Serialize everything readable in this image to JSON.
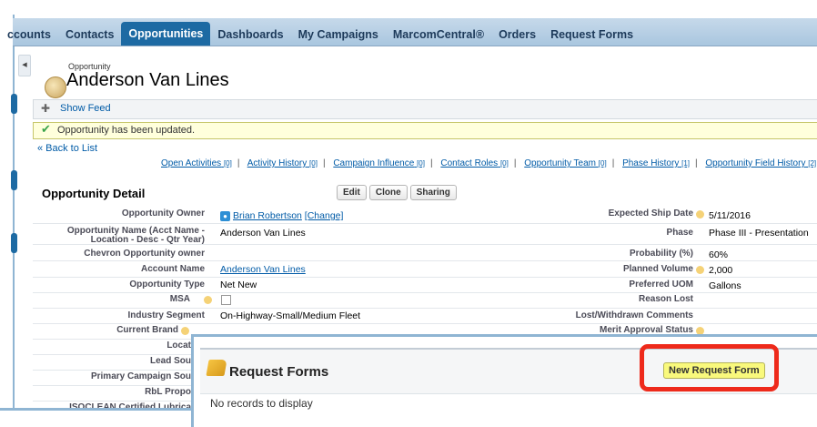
{
  "nav": {
    "tabs": [
      "ccounts",
      "Contacts",
      "Opportunities",
      "Dashboards",
      "My Campaigns",
      "MarcomCentral®",
      "Orders",
      "Request Forms"
    ],
    "active_tab": "Opportunities"
  },
  "header": {
    "object_label": "Opportunity",
    "title": "Anderson Van Lines"
  },
  "feed": {
    "show_feed": "Show Feed"
  },
  "message": {
    "text": "Opportunity has been updated."
  },
  "back_link": "« Back to List",
  "related_lists": [
    {
      "label": "Open Activities",
      "count": "[0]"
    },
    {
      "label": "Activity History",
      "count": "[0]"
    },
    {
      "label": "Campaign Influence",
      "count": "[0]"
    },
    {
      "label": "Contact Roles",
      "count": "[0]"
    },
    {
      "label": "Opportunity Team",
      "count": "[0]"
    },
    {
      "label": "Phase History",
      "count": "[1]"
    },
    {
      "label": "Opportunity Field History",
      "count": "[2]"
    }
  ],
  "detail": {
    "title": "Opportunity Detail",
    "buttons": {
      "edit": "Edit",
      "clone": "Clone",
      "sharing": "Sharing"
    },
    "left_fields": {
      "owner_label": "Opportunity Owner",
      "owner_value": "Brian Robertson",
      "owner_change": "[Change]",
      "name_label_1": "Opportunity Name (Acct Name -",
      "name_label_2": "Location - Desc - Qtr Year)",
      "name_value": "Anderson Van Lines",
      "chevron_label": "Chevron Opportunity owner",
      "account_label": "Account Name",
      "account_value": "Anderson Van Lines",
      "type_label": "Opportunity Type",
      "type_value": "Net New",
      "msa_label": "MSA",
      "segment_label": "Industry Segment",
      "segment_value": "On-Highway-Small/Medium Fleet",
      "brand_label": "Current Brand",
      "locat_label": "Locat",
      "lead_label": "Lead Sou",
      "primary_label": "Primary Campaign Sou",
      "rbl_label": "RbL Propo",
      "isoclean_label": "ISOCLEAN Certified Lubrica"
    },
    "right_fields": {
      "ship_label": "Expected Ship Date",
      "ship_value": "5/11/2016",
      "phase_label": "Phase",
      "phase_value": "Phase III - Presentation",
      "prob_label": "Probability (%)",
      "prob_value": "60%",
      "volume_label": "Planned Volume",
      "volume_value": "2,000",
      "uom_label": "Preferred UOM",
      "uom_value": "Gallons",
      "reason_label": "Reason Lost",
      "lost_label": "Lost/Withdrawn Comments",
      "merit_label": "Merit Approval Status"
    }
  },
  "request_forms": {
    "title": "Request Forms",
    "new_button": "New Request Form",
    "empty": "No records to display"
  },
  "colors": {
    "nav_active": "#1d6aa3",
    "link": "#015ba7",
    "highlight": "#ee2a1b"
  }
}
